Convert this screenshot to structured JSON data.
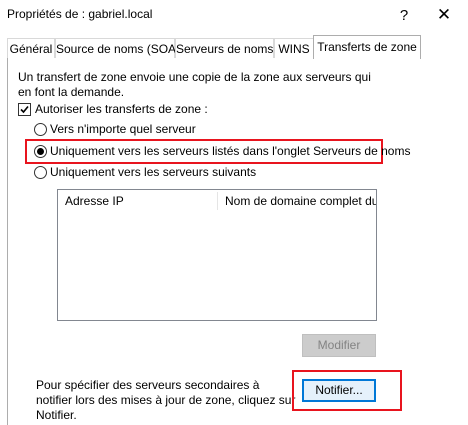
{
  "window": {
    "title": "Propriétés de : gabriel.local",
    "help_glyph": "?",
    "close_glyph": "✕"
  },
  "tabs": [
    {
      "label": "Général",
      "active": false
    },
    {
      "label": "Source de noms (SOA)",
      "active": false
    },
    {
      "label": "Serveurs de noms",
      "active": false
    },
    {
      "label": "WINS",
      "active": false
    },
    {
      "label": "Transferts de zone",
      "active": true
    }
  ],
  "panel": {
    "description": "Un transfert de zone envoie une copie de la zone aux serveurs qui en font la demande.",
    "allow_transfers": {
      "label": "Autoriser les transferts de zone :",
      "checked": true
    },
    "radios": [
      {
        "label": "Vers n'importe quel serveur",
        "selected": false
      },
      {
        "label": "Uniquement vers les serveurs listés dans l'onglet Serveurs de noms",
        "selected": true
      },
      {
        "label": "Uniquement vers les serveurs suivants",
        "selected": false
      }
    ],
    "server_list": {
      "columns": [
        "Adresse IP",
        "Nom de domaine complet du..."
      ],
      "rows": []
    },
    "modify_button": "Modifier",
    "notify_text": "Pour spécifier des serveurs secondaires à notifier lors des mises à jour de zone, cliquez sur Notifier.",
    "notify_button": "Notifier..."
  },
  "colors": {
    "highlight": "#e8141e",
    "focus_border": "#0078d7"
  }
}
